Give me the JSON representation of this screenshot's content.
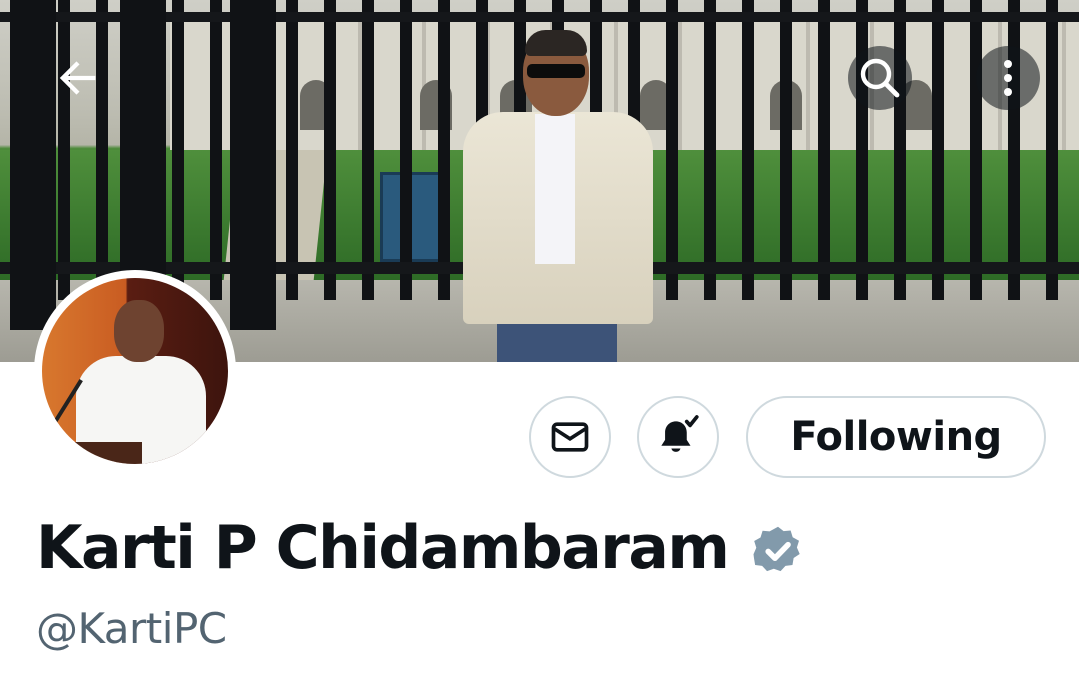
{
  "header": {
    "back_icon": "arrow-left-icon",
    "search_icon": "search-icon",
    "more_icon": "more-vertical-icon"
  },
  "profile": {
    "display_name": "Karti P Chidambaram",
    "handle": "@KartiPC",
    "verified_badge": "verified-badge-icon",
    "verified_color": "#829aab"
  },
  "actions": {
    "message_icon": "mail-icon",
    "notify_icon": "bell-check-icon",
    "following_label": "Following"
  },
  "colors": {
    "text_primary": "#0f1419",
    "text_secondary": "#536471",
    "border": "#cfd9de"
  }
}
